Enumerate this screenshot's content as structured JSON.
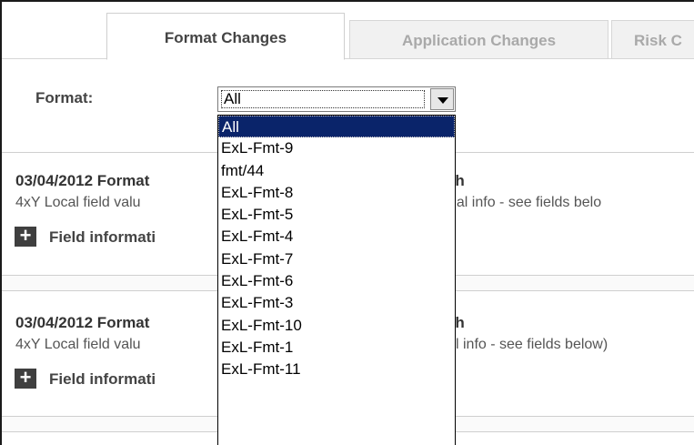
{
  "tabs": [
    {
      "label": "Format Changes",
      "active": true
    },
    {
      "label": "Application Changes",
      "active": false
    },
    {
      "label": "Risk C",
      "active": false
    }
  ],
  "filter": {
    "label": "Format:",
    "selected_value": "All",
    "options": [
      "All",
      "ExL-Fmt-9",
      "fmt/44",
      "ExL-Fmt-8",
      "ExL-Fmt-5",
      "ExL-Fmt-4",
      "ExL-Fmt-7",
      "ExL-Fmt-6",
      "ExL-Fmt-3",
      "ExL-Fmt-10",
      "ExL-Fmt-1",
      "ExL-Fmt-11"
    ]
  },
  "records": [
    {
      "title": "03/04/2012 Format",
      "name": "ith",
      "description": "4xY Local field valu",
      "description_right": "nal info - see fields belo",
      "field_info_label": "Field informati",
      "toggle_symbol": "+"
    },
    {
      "title": "03/04/2012 Format",
      "name": "ith",
      "description": "4xY Local field valu",
      "description_right": "l info - see fields below)",
      "field_info_label": "Field informati",
      "toggle_symbol": "+"
    }
  ],
  "colors": {
    "selected_option_bg": "#0a246a",
    "toggle_bg": "#3f3f3f"
  }
}
